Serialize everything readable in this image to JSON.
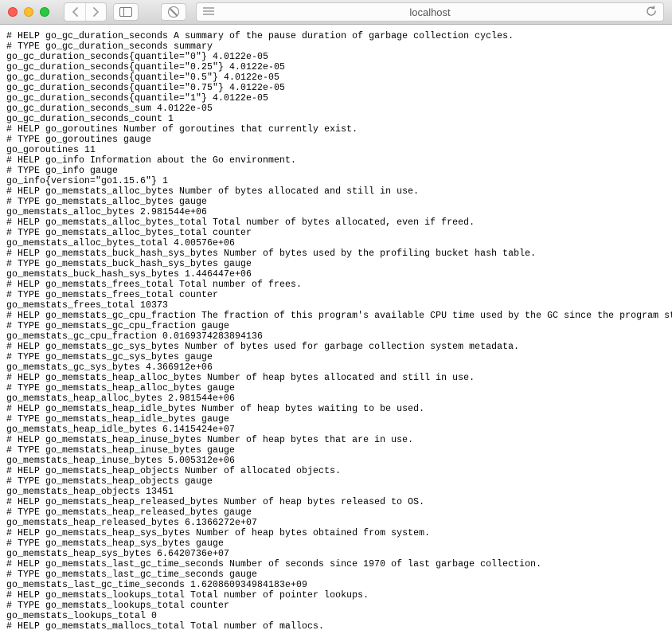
{
  "browser": {
    "url": "localhost"
  },
  "metrics": [
    "# HELP go_gc_duration_seconds A summary of the pause duration of garbage collection cycles.",
    "# TYPE go_gc_duration_seconds summary",
    "go_gc_duration_seconds{quantile=\"0\"} 4.0122e-05",
    "go_gc_duration_seconds{quantile=\"0.25\"} 4.0122e-05",
    "go_gc_duration_seconds{quantile=\"0.5\"} 4.0122e-05",
    "go_gc_duration_seconds{quantile=\"0.75\"} 4.0122e-05",
    "go_gc_duration_seconds{quantile=\"1\"} 4.0122e-05",
    "go_gc_duration_seconds_sum 4.0122e-05",
    "go_gc_duration_seconds_count 1",
    "# HELP go_goroutines Number of goroutines that currently exist.",
    "# TYPE go_goroutines gauge",
    "go_goroutines 11",
    "# HELP go_info Information about the Go environment.",
    "# TYPE go_info gauge",
    "go_info{version=\"go1.15.6\"} 1",
    "# HELP go_memstats_alloc_bytes Number of bytes allocated and still in use.",
    "# TYPE go_memstats_alloc_bytes gauge",
    "go_memstats_alloc_bytes 2.981544e+06",
    "# HELP go_memstats_alloc_bytes_total Total number of bytes allocated, even if freed.",
    "# TYPE go_memstats_alloc_bytes_total counter",
    "go_memstats_alloc_bytes_total 4.00576e+06",
    "# HELP go_memstats_buck_hash_sys_bytes Number of bytes used by the profiling bucket hash table.",
    "# TYPE go_memstats_buck_hash_sys_bytes gauge",
    "go_memstats_buck_hash_sys_bytes 1.446447e+06",
    "# HELP go_memstats_frees_total Total number of frees.",
    "# TYPE go_memstats_frees_total counter",
    "go_memstats_frees_total 10373",
    "# HELP go_memstats_gc_cpu_fraction The fraction of this program's available CPU time used by the GC since the program started.",
    "# TYPE go_memstats_gc_cpu_fraction gauge",
    "go_memstats_gc_cpu_fraction 0.0169374283894136",
    "# HELP go_memstats_gc_sys_bytes Number of bytes used for garbage collection system metadata.",
    "# TYPE go_memstats_gc_sys_bytes gauge",
    "go_memstats_gc_sys_bytes 4.366912e+06",
    "# HELP go_memstats_heap_alloc_bytes Number of heap bytes allocated and still in use.",
    "# TYPE go_memstats_heap_alloc_bytes gauge",
    "go_memstats_heap_alloc_bytes 2.981544e+06",
    "# HELP go_memstats_heap_idle_bytes Number of heap bytes waiting to be used.",
    "# TYPE go_memstats_heap_idle_bytes gauge",
    "go_memstats_heap_idle_bytes 6.1415424e+07",
    "# HELP go_memstats_heap_inuse_bytes Number of heap bytes that are in use.",
    "# TYPE go_memstats_heap_inuse_bytes gauge",
    "go_memstats_heap_inuse_bytes 5.005312e+06",
    "# HELP go_memstats_heap_objects Number of allocated objects.",
    "# TYPE go_memstats_heap_objects gauge",
    "go_memstats_heap_objects 13451",
    "# HELP go_memstats_heap_released_bytes Number of heap bytes released to OS.",
    "# TYPE go_memstats_heap_released_bytes gauge",
    "go_memstats_heap_released_bytes 6.1366272e+07",
    "# HELP go_memstats_heap_sys_bytes Number of heap bytes obtained from system.",
    "# TYPE go_memstats_heap_sys_bytes gauge",
    "go_memstats_heap_sys_bytes 6.6420736e+07",
    "# HELP go_memstats_last_gc_time_seconds Number of seconds since 1970 of last garbage collection.",
    "# TYPE go_memstats_last_gc_time_seconds gauge",
    "go_memstats_last_gc_time_seconds 1.620860934984183e+09",
    "# HELP go_memstats_lookups_total Total number of pointer lookups.",
    "# TYPE go_memstats_lookups_total counter",
    "go_memstats_lookups_total 0",
    "# HELP go_memstats_mallocs_total Total number of mallocs."
  ]
}
